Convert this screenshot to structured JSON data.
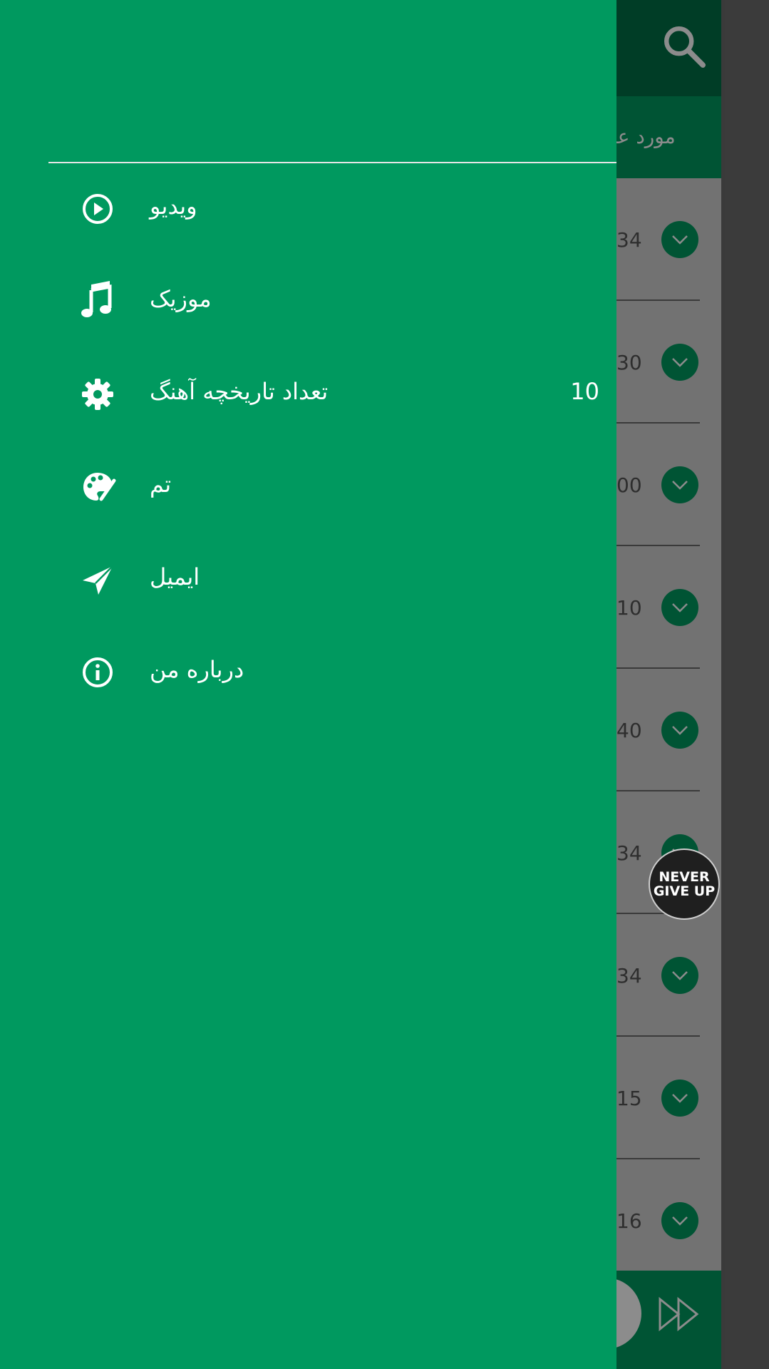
{
  "colors": {
    "primary": "#00995f",
    "primary_dark": "#006f45",
    "on_primary": "#ffffff"
  },
  "background": {
    "tab_label": "مورد علا",
    "list_numbers": [
      "34",
      "30",
      "00",
      "10",
      "40",
      "34",
      "34",
      "15",
      "16"
    ]
  },
  "floating_badge": {
    "line1": "NEVER",
    "line2": "GIVE UP"
  },
  "drawer": {
    "items": [
      {
        "label": "ویدیو",
        "icon": "play-circle-icon"
      },
      {
        "label": "موزیک",
        "icon": "music-note-icon"
      },
      {
        "label": "تعداد تاریخچه آهنگ",
        "icon": "gear-icon",
        "value": "10"
      },
      {
        "label": "تم",
        "icon": "palette-icon"
      },
      {
        "label": "ایمیل",
        "icon": "paper-plane-icon"
      },
      {
        "label": "درباره من",
        "icon": "info-icon"
      }
    ]
  }
}
